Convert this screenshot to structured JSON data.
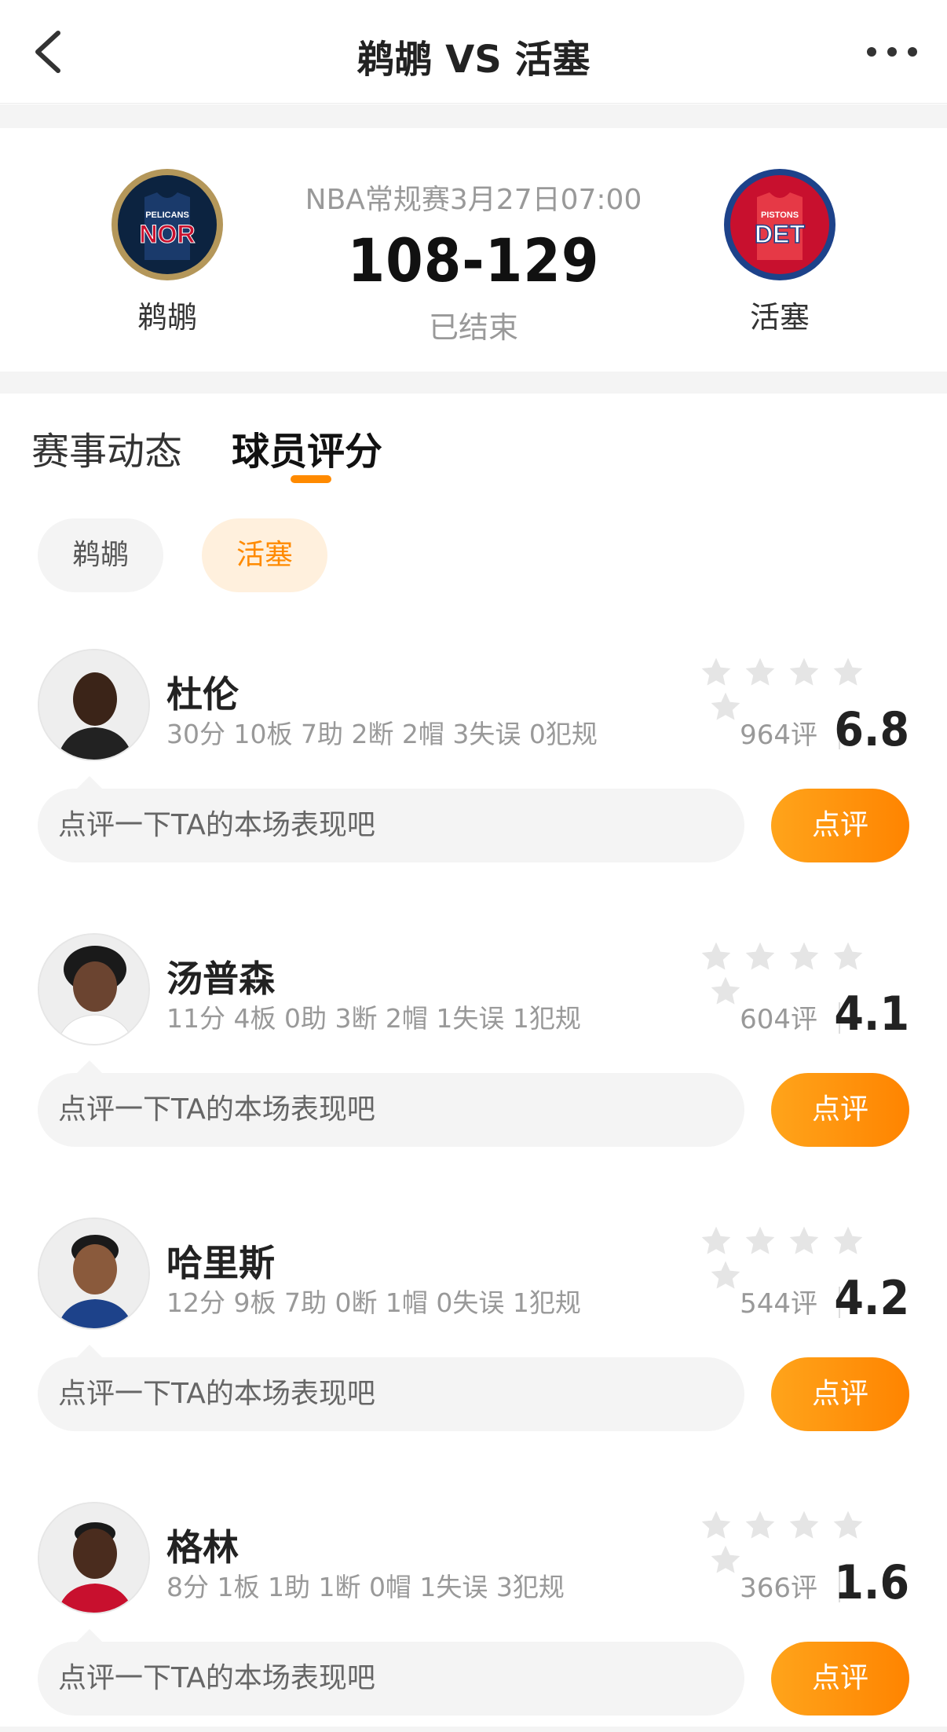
{
  "nav": {
    "title": "鹈鹕 VS 活塞"
  },
  "match": {
    "home": {
      "name": "鹈鹕",
      "logo_top": "PELICANS",
      "logo_abbr": "NOR",
      "color": "#0c2340",
      "accent": "#c8102e",
      "ring": "#b4975a"
    },
    "away": {
      "name": "活塞",
      "logo_top": "PISTONS",
      "logo_abbr": "DET",
      "color": "#1d428a",
      "accent": "#c8102e",
      "ring": "#1d428a"
    },
    "meta": "NBA常规赛3月27日07:00",
    "score": "108-129",
    "status": "已结束"
  },
  "tabs": [
    {
      "label": "赛事动态",
      "active": false
    },
    {
      "label": "球员评分",
      "active": true
    }
  ],
  "team_filter": [
    {
      "label": "鹈鹕",
      "active": false
    },
    {
      "label": "活塞",
      "active": true
    }
  ],
  "players": [
    {
      "name": "杜伦",
      "stats": "30分 10板 7助 2断 2帽 3失误 0犯规",
      "rating_count": "964评",
      "rating": "6.8",
      "comment_placeholder": "点评一下TA的本场表现吧",
      "button": "点评"
    },
    {
      "name": "汤普森",
      "stats": "11分 4板 0助 3断 2帽 1失误 1犯规",
      "rating_count": "604评",
      "rating": "4.1",
      "comment_placeholder": "点评一下TA的本场表现吧",
      "button": "点评"
    },
    {
      "name": "哈里斯",
      "stats": "12分 9板 7助 0断 1帽 0失误 1犯规",
      "rating_count": "544评",
      "rating": "4.2",
      "comment_placeholder": "点评一下TA的本场表现吧",
      "button": "点评"
    },
    {
      "name": "格林",
      "stats": "8分 1板 1助 1断 0帽 1失误 3犯规",
      "rating_count": "366评",
      "rating": "1.6",
      "comment_placeholder": "点评一下TA的本场表现吧",
      "button": "点评"
    }
  ],
  "colors": {
    "accent": "#ff8a00",
    "star_empty": "#e5e5e5"
  }
}
